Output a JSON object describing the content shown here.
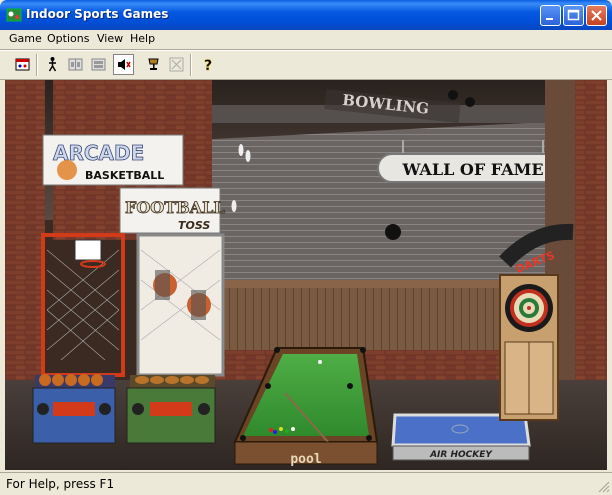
{
  "window": {
    "title": "Indoor Sports Games"
  },
  "menu": {
    "items": [
      "Game",
      "Options",
      "View",
      "Help"
    ]
  },
  "toolbar": {
    "tools": [
      "new-game-icon",
      "player-icon",
      "scoreboard-icon",
      "panel-icon",
      "sound-icon",
      "trophy-icon",
      "disabled-icon",
      "help-icon"
    ]
  },
  "scene": {
    "arcade_sign_line1": "ARCADE",
    "arcade_sign_line2": "BASKETBALL",
    "football_sign_line1": "FOOTBALL",
    "football_sign_line2": "TOSS",
    "bowling_sign": "BOWLING",
    "wall_of_fame": "WALL OF FAME",
    "darts_sign": "DARTS",
    "air_hockey_label": "AIR HOCKEY",
    "pool_label": "pool"
  },
  "status": {
    "text": "For Help, press F1"
  },
  "colors": {
    "titlebar": "#0054e3",
    "chrome": "#ece9d8",
    "felt": "#3f9a3a",
    "brick": "#7a3a2a"
  }
}
